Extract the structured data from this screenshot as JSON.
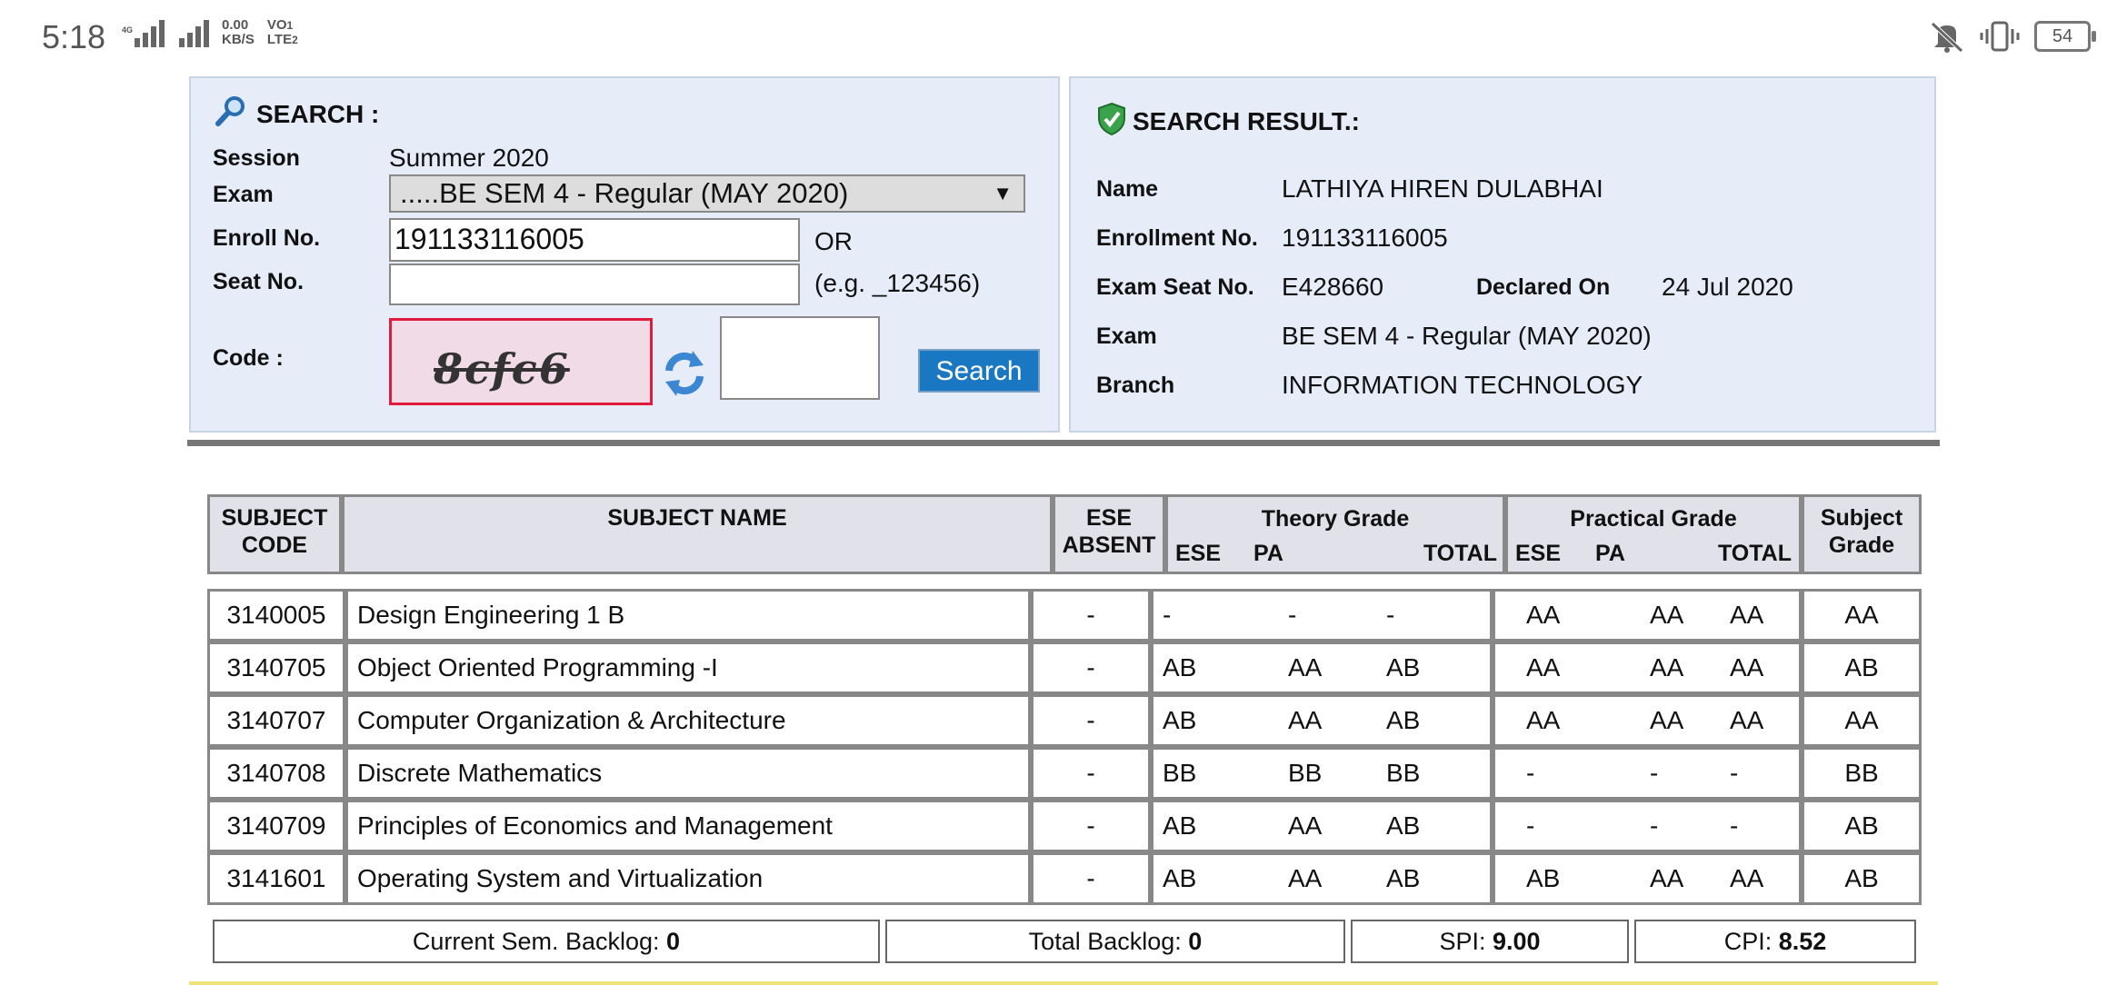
{
  "status_bar": {
    "time": "5:18",
    "net_type": "4G",
    "speed_value": "0.00",
    "speed_unit": "KB/S",
    "volte1": "VO",
    "volte2": "LTE",
    "sim1": "1",
    "sim2": "2",
    "battery": "54",
    "icons": [
      "signal-icon",
      "vibrate-icon",
      "mute-icon",
      "battery-icon"
    ]
  },
  "search": {
    "title": "SEARCH :",
    "session_label": "Session",
    "session_value": "Summer 2020",
    "exam_label": "Exam",
    "exam_selected": ".....BE SEM 4 - Regular (MAY 2020)",
    "enroll_label": "Enroll No.",
    "enroll_value": "191133116005",
    "or_text": "OR",
    "seat_label": "Seat No.",
    "seat_value": "",
    "seat_hint": "(e.g. _123456)",
    "code_label": "Code :",
    "captcha_text": "8cfc6",
    "code_value": "",
    "search_button": "Search"
  },
  "result": {
    "title": "SEARCH RESULT.:",
    "name_label": "Name",
    "name_value": "LATHIYA HIREN DULABHAI",
    "enrollment_label": "Enrollment No.",
    "enrollment_value": "191133116005",
    "seat_label": "Exam Seat No.",
    "seat_value": "E428660",
    "declared_label": "Declared On",
    "declared_value": "24 Jul 2020",
    "exam_label": "Exam",
    "exam_value": "BE SEM 4 - Regular (MAY 2020)",
    "branch_label": "Branch",
    "branch_value": "INFORMATION TECHNOLOGY"
  },
  "table": {
    "headers": {
      "subject_code_1": "SUBJECT",
      "subject_code_2": "CODE",
      "subject_name": "SUBJECT NAME",
      "ese_absent_1": "ESE",
      "ese_absent_2": "ABSENT",
      "theory_grade": "Theory Grade",
      "practical_grade": "Practical Grade",
      "subject_grade_1": "Subject",
      "subject_grade_2": "Grade",
      "ese": "ESE",
      "pa": "PA",
      "total": "TOTAL"
    },
    "rows": [
      {
        "code": "3140005",
        "name": "Design Engineering 1 B",
        "ese_absent": "-",
        "th_ese": "-",
        "th_pa": "-",
        "th_total": "-",
        "pr_ese": "AA",
        "pr_pa": "AA",
        "pr_total": "AA",
        "grade": "AA"
      },
      {
        "code": "3140705",
        "name": "Object Oriented Programming -I",
        "ese_absent": "-",
        "th_ese": "AB",
        "th_pa": "AA",
        "th_total": "AB",
        "pr_ese": "AA",
        "pr_pa": "AA",
        "pr_total": "AA",
        "grade": "AB"
      },
      {
        "code": "3140707",
        "name": "Computer Organization & Architecture",
        "ese_absent": "-",
        "th_ese": "AB",
        "th_pa": "AA",
        "th_total": "AB",
        "pr_ese": "AA",
        "pr_pa": "AA",
        "pr_total": "AA",
        "grade": "AA"
      },
      {
        "code": "3140708",
        "name": "Discrete Mathematics",
        "ese_absent": "-",
        "th_ese": "BB",
        "th_pa": "BB",
        "th_total": "BB",
        "pr_ese": "-",
        "pr_pa": "-",
        "pr_total": "-",
        "grade": "BB"
      },
      {
        "code": "3140709",
        "name": "Principles of Economics and Management",
        "ese_absent": "-",
        "th_ese": "AB",
        "th_pa": "AA",
        "th_total": "AB",
        "pr_ese": "-",
        "pr_pa": "-",
        "pr_total": "-",
        "grade": "AB"
      },
      {
        "code": "3141601",
        "name": "Operating System and Virtualization",
        "ese_absent": "-",
        "th_ese": "AB",
        "th_pa": "AA",
        "th_total": "AB",
        "pr_ese": "AB",
        "pr_pa": "AA",
        "pr_total": "AA",
        "grade": "AB"
      }
    ]
  },
  "footer": {
    "current_backlog_label": "Current Sem. Backlog:",
    "current_backlog_value": "0",
    "total_backlog_label": "Total Backlog:",
    "total_backlog_value": "0",
    "spi_label": "SPI:",
    "spi_value": "9.00",
    "cpi_label": "CPI:",
    "cpi_value": "8.52"
  },
  "colors": {
    "panel_bg": "#e6edf8",
    "accent": "#1a78c2",
    "captcha_border": "#e01b3c",
    "table_border": "#888888"
  }
}
